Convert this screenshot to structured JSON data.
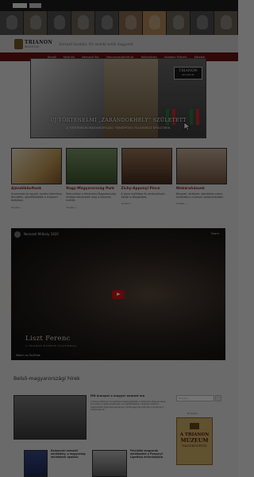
{
  "topbar": {
    "search_placeholder": "",
    "button_label": ""
  },
  "logo": {
    "name": "TRIANON",
    "sub": "MÚZEUM"
  },
  "motto": "Szeresd hazádat. Ne mondd senki magyarát",
  "nav": [
    "Kezdő",
    "Köztünk",
    "Nemzeti Kör",
    "Magyarságtörténet",
    "Tollaskódex",
    "Irodalmi Műhely",
    "Kötetek",
    "Múzeum Info"
  ],
  "hero": {
    "badge_line1": "TRIANON",
    "badge_line2": "MÚZEUM",
    "title": "ÚJ TÖRTÉNELMI „ZARÁNDOKHELY” SZÜLETETT",
    "subtitle": "A TÖRTÉNELMI MAGYARORSZÁG TÉRKÉPÉVEL FELSZERELT ÉPÜLETBEN"
  },
  "cards": [
    {
      "caption": "Ajándékboltunk",
      "desc": "Szuvenírek és egyedi, kortárs kézműves termékek, ajándékötletek a múzeum boltjában.",
      "more": "Tovább »"
    },
    {
      "caption": "Nagy-Magyarország Park",
      "desc": "Parkunkban a történelmi Magyarország térképe elevenedik meg a múzeum mellett.",
      "more": "Tovább »"
    },
    {
      "caption": "Zichy-Apponyi Pince",
      "desc": "A pince kiállításai és rendezvényei várják a látogatókat.",
      "more": "Tovább »"
    },
    {
      "caption": "Webáruházunk",
      "desc": "Könyvek, térképek, ajándékok online rendelése a múzeum webáruházából.",
      "more": "Tovább »"
    }
  ],
  "video": {
    "title": "Nemzeti Műhely 1920",
    "share": "Share",
    "name": "Liszt Ferenc",
    "caption": "A TRIANON MÚZEUM CSATORNÁJA",
    "platform": "Watch on YouTube"
  },
  "news": {
    "header": "Belső-magyarországi hírek",
    "feature_title": "Mit ünnepel a magyar nemzet ma",
    "feature_body": "A Trianon Múzeum munkatársai összegyűjtötték a történelmi Magyarország hírei közül a legfontosabbakat. Az összeállításban a Kárpát-medence magyarlakta régióinak eseményei, emléknapjai és kulturális programjai is helyet kapnak.",
    "a_title": "Kolozsvári nemzeti emlékhely, a magyarság emlékének ápolása",
    "b_title": "Felvidéki magyarok emlékeztek a Pozsonyi Ligetfalu évfordulójára"
  },
  "sidebar": {
    "search_placeholder": "Keresés...",
    "label": "Hirdetés",
    "ad_line1": "A TRIANON",
    "ad_line2": "MÚZEUM",
    "ad_line3": "NAGYKÖVETEI"
  }
}
